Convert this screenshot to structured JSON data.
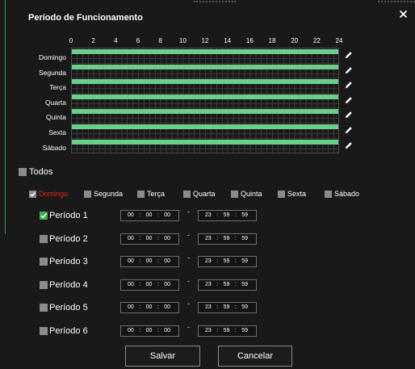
{
  "dialog": {
    "title": "Período de Funcionamento"
  },
  "icons": {
    "close": "close-icon",
    "edit": "pencil-icon",
    "check": "checkmark-icon"
  },
  "colors": {
    "background": "#191919",
    "schedule_bar": "#6acf8b",
    "checked_period": "#35b24a",
    "selected_day_label": "#e32119"
  },
  "schedule": {
    "hours": [
      "0",
      "2",
      "4",
      "6",
      "8",
      "10",
      "12",
      "14",
      "16",
      "18",
      "20",
      "22",
      "24"
    ],
    "days": [
      {
        "label": "Domingo",
        "segments": [
          {
            "start": 0,
            "end": 24
          }
        ]
      },
      {
        "label": "Segunda",
        "segments": [
          {
            "start": 0,
            "end": 24
          }
        ]
      },
      {
        "label": "Terça",
        "segments": [
          {
            "start": 0,
            "end": 24
          }
        ]
      },
      {
        "label": "Quarta",
        "segments": [
          {
            "start": 0,
            "end": 24
          }
        ]
      },
      {
        "label": "Quinta",
        "segments": [
          {
            "start": 0,
            "end": 24
          }
        ]
      },
      {
        "label": "Sexta",
        "segments": [
          {
            "start": 0,
            "end": 24
          }
        ]
      },
      {
        "label": "Sábado",
        "segments": [
          {
            "start": 0,
            "end": 24
          }
        ]
      }
    ]
  },
  "select_all": {
    "label": "Todos",
    "checked": false
  },
  "apply_days": [
    {
      "label": "Domingo",
      "checked": true
    },
    {
      "label": "Segunda",
      "checked": false
    },
    {
      "label": "Terça",
      "checked": false
    },
    {
      "label": "Quarta",
      "checked": false
    },
    {
      "label": "Quinta",
      "checked": false
    },
    {
      "label": "Sexta",
      "checked": false
    },
    {
      "label": "Sábado",
      "checked": false
    }
  ],
  "time_separator": ":",
  "range_separator": "-",
  "periods": [
    {
      "label": "Período 1",
      "checked": true,
      "start": [
        "00",
        "00",
        "00"
      ],
      "end": [
        "23",
        "59",
        "59"
      ]
    },
    {
      "label": "Período 2",
      "checked": false,
      "start": [
        "00",
        "00",
        "00"
      ],
      "end": [
        "23",
        "59",
        "59"
      ]
    },
    {
      "label": "Período 3",
      "checked": false,
      "start": [
        "00",
        "00",
        "00"
      ],
      "end": [
        "23",
        "59",
        "59"
      ]
    },
    {
      "label": "Período 4",
      "checked": false,
      "start": [
        "00",
        "00",
        "00"
      ],
      "end": [
        "23",
        "59",
        "59"
      ]
    },
    {
      "label": "Período 5",
      "checked": false,
      "start": [
        "00",
        "00",
        "00"
      ],
      "end": [
        "23",
        "59",
        "59"
      ]
    },
    {
      "label": "Período 6",
      "checked": false,
      "start": [
        "00",
        "00",
        "00"
      ],
      "end": [
        "23",
        "59",
        "59"
      ]
    }
  ],
  "buttons": {
    "save": "Salvar",
    "cancel": "Cancelar"
  }
}
